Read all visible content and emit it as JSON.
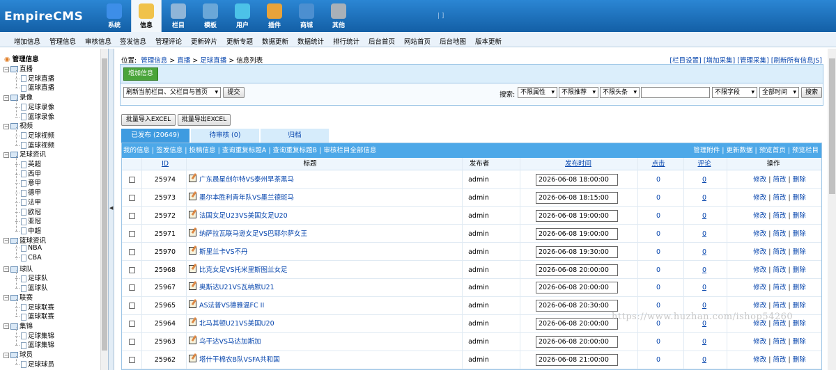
{
  "app": {
    "logo": "EmpireCMS"
  },
  "topnav": [
    {
      "label": "系统",
      "icon": "globe-icon",
      "color": "#3d8ee8",
      "active": false
    },
    {
      "label": "信息",
      "icon": "edit-icon",
      "color": "#f0c24a",
      "active": true
    },
    {
      "label": "栏目",
      "icon": "folder-icon",
      "color": "#8fb5d8",
      "active": false
    },
    {
      "label": "模板",
      "icon": "template-icon",
      "color": "#6aa7d8",
      "active": false
    },
    {
      "label": "用户",
      "icon": "user-icon",
      "color": "#4cc2e8",
      "active": false
    },
    {
      "label": "插件",
      "icon": "tools-icon",
      "color": "#e8a33a",
      "active": false
    },
    {
      "label": "商城",
      "icon": "shop-icon",
      "color": "#4c8fd0",
      "active": false
    },
    {
      "label": "其他",
      "icon": "gear-icon",
      "color": "#a8b0b8",
      "active": false
    }
  ],
  "userinfo": "|             ]",
  "menubar": [
    "增加信息",
    "管理信息",
    "审核信息",
    "签发信息",
    "管理评论",
    "更新碎片",
    "更新专题",
    "数据更新",
    "数据统计",
    "排行统计",
    "后台首页",
    "网站首页",
    "后台地图",
    "版本更新"
  ],
  "tree": {
    "title": "管理信息",
    "groups": [
      {
        "label": "直播",
        "children": [
          "足球直播",
          "篮球直播"
        ]
      },
      {
        "label": "录像",
        "children": [
          "足球录像",
          "篮球录像"
        ]
      },
      {
        "label": "视频",
        "children": [
          "足球视频",
          "篮球视频"
        ]
      },
      {
        "label": "足球资讯",
        "children": [
          "英超",
          "西甲",
          "意甲",
          "德甲",
          "法甲",
          "欧冠",
          "亚冠",
          "中超"
        ]
      },
      {
        "label": "篮球资讯",
        "children": [
          "NBA",
          "CBA"
        ]
      },
      {
        "label": "球队",
        "children": [
          "足球队",
          "篮球队"
        ]
      },
      {
        "label": "联赛",
        "children": [
          "足球联赛",
          "篮球联赛"
        ]
      },
      {
        "label": "集锦",
        "children": [
          "足球集锦",
          "篮球集锦"
        ]
      },
      {
        "label": "球员",
        "children": [
          "足球球员"
        ]
      }
    ]
  },
  "position": {
    "label": "位置:",
    "crumbs": [
      "管理信息",
      "直播",
      "足球直播"
    ],
    "current": "信息列表"
  },
  "toplinks": [
    "[栏目设置]",
    "[增加采集]",
    "[管理采集]",
    "[刷新所有信息JS]"
  ],
  "toolbar": {
    "add_button": "增加信息",
    "refresh_select": "刷新当前栏目、父栏目与首页",
    "submit": "提交",
    "search_label": "搜索:",
    "filters": [
      "不限属性",
      "不限推荐",
      "不限头条"
    ],
    "search_value": "",
    "field_select": "不限字段",
    "time_select": "全部时间",
    "search_button": "搜索"
  },
  "excel": {
    "import": "批量导入EXCEL",
    "export": "批量导出EXCEL"
  },
  "tabs": [
    {
      "label": "已发布 (20649)",
      "active": true
    },
    {
      "label": "待审核 (0)",
      "active": false
    },
    {
      "label": "归档",
      "active": false
    }
  ],
  "gridlinks": {
    "left": [
      "我的信息",
      "签发信息",
      "投稿信息",
      "查询重复标题A",
      "查询重复标题B",
      "审核栏目全部信息"
    ],
    "right": [
      "管理附件",
      "更新数据",
      "预览首页",
      "预览栏目"
    ]
  },
  "columns": {
    "id": "ID",
    "title": "标题",
    "publisher": "发布者",
    "time": "发布时间",
    "clicks": "点击",
    "comments": "评论",
    "ops": "操作"
  },
  "op_labels": [
    "修改",
    "简改",
    "删除"
  ],
  "rows": [
    {
      "id": "25974",
      "title": "广东晨星创尔特VS泰州早茶黑马",
      "publisher": "admin",
      "time": "2026-06-08 18:00:00",
      "clicks": "0",
      "comments": "0"
    },
    {
      "id": "25973",
      "title": "墨尔本胜利青年队VS墨兰德斑马",
      "publisher": "admin",
      "time": "2026-06-08 18:15:00",
      "clicks": "0",
      "comments": "0"
    },
    {
      "id": "25972",
      "title": "法国女足U23VS美国女足U20",
      "publisher": "admin",
      "time": "2026-06-08 19:00:00",
      "clicks": "0",
      "comments": "0"
    },
    {
      "id": "25971",
      "title": "纳萨拉瓦联马逊女足VS巴耶尔萨女王",
      "publisher": "admin",
      "time": "2026-06-08 19:00:00",
      "clicks": "0",
      "comments": "0"
    },
    {
      "id": "25970",
      "title": "斯里兰卡VS不丹",
      "publisher": "admin",
      "time": "2026-06-08 19:30:00",
      "clicks": "0",
      "comments": "0"
    },
    {
      "id": "25968",
      "title": "比克女足VS托米里斯图兰女足",
      "publisher": "admin",
      "time": "2026-06-08 20:00:00",
      "clicks": "0",
      "comments": "0"
    },
    {
      "id": "25967",
      "title": "奥斯达U21VS瓦纳默U21",
      "publisher": "admin",
      "time": "2026-06-08 20:00:00",
      "clicks": "0",
      "comments": "0"
    },
    {
      "id": "25965",
      "title": "AS法普VS德雅温FC II",
      "publisher": "admin",
      "time": "2026-06-08 20:30:00",
      "clicks": "0",
      "comments": "0"
    },
    {
      "id": "25964",
      "title": "北马其顿U21VS美国U20",
      "publisher": "admin",
      "time": "2026-06-08 20:00:00",
      "clicks": "0",
      "comments": "0"
    },
    {
      "id": "25963",
      "title": "乌干达VS马达加斯加",
      "publisher": "admin",
      "time": "2026-06-08 20:00:00",
      "clicks": "0",
      "comments": "0"
    },
    {
      "id": "25962",
      "title": "塔什干棉农B队VSFA共和国",
      "publisher": "admin",
      "time": "2026-06-08 21:00:00",
      "clicks": "0",
      "comments": "0"
    }
  ],
  "watermark": "https://www.huzhan.com/ishop54260"
}
